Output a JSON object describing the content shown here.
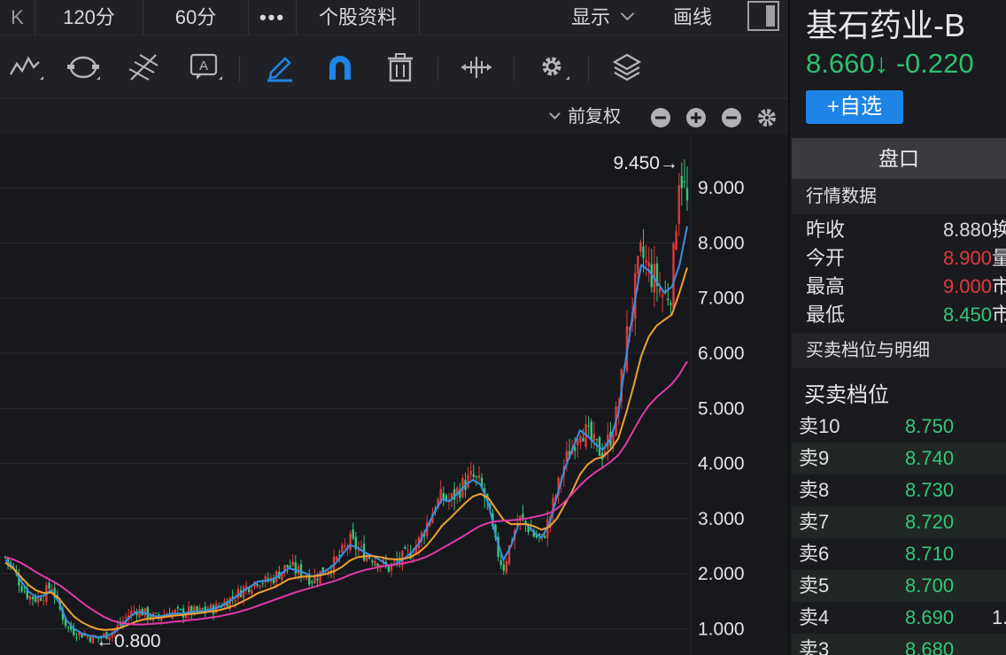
{
  "topbar": {
    "tabs": [
      {
        "label": "K"
      },
      {
        "label": "120分"
      },
      {
        "label": "60分"
      },
      {
        "label": "•••"
      },
      {
        "label": "个股资料"
      }
    ],
    "display_label": "显示",
    "draw_label": "画线"
  },
  "toolbar": {
    "icons": [
      "trendline-icon",
      "cycle-icon",
      "fan-icon",
      "text-annotation-icon",
      "pen-icon",
      "magnet-icon",
      "trash-icon",
      "measure-icon",
      "settings-icon",
      "layers-icon"
    ],
    "active_color": "#1e84e5"
  },
  "subbar": {
    "adjust_label": "前复权",
    "buttons": [
      "zoom-minus-icon",
      "zoom-plus-icon",
      "minus-icon",
      "gear-icon"
    ]
  },
  "chart_data": {
    "type": "candlestick",
    "y_ticks": [
      "9.000",
      "8.000",
      "7.000",
      "6.000",
      "5.000",
      "4.000",
      "3.000",
      "2.000",
      "1.000"
    ],
    "ylim": [
      0.8,
      9.45
    ],
    "grid": true,
    "annotations": {
      "high": "9.450→",
      "low": "←0.800"
    },
    "close": [
      2.3,
      2.1,
      1.8,
      1.6,
      1.55,
      1.62,
      1.8,
      1.4,
      1.05,
      0.95,
      0.9,
      0.85,
      0.82,
      0.88,
      0.95,
      1.08,
      1.25,
      1.35,
      1.3,
      1.22,
      1.2,
      1.28,
      1.3,
      1.28,
      1.32,
      1.3,
      1.35,
      1.36,
      1.42,
      1.52,
      1.6,
      1.72,
      1.8,
      1.9,
      1.85,
      1.92,
      2.05,
      2.15,
      2.05,
      2.0,
      1.9,
      2.0,
      2.1,
      2.2,
      2.4,
      2.6,
      2.45,
      2.35,
      2.3,
      2.2,
      2.1,
      2.2,
      2.3,
      2.4,
      2.6,
      2.9,
      3.2,
      3.4,
      3.3,
      3.5,
      3.65,
      3.75,
      3.6,
      3.2,
      2.5,
      2.1,
      2.6,
      3.0,
      2.9,
      2.7,
      2.6,
      3.0,
      3.5,
      4.0,
      4.3,
      4.7,
      4.5,
      4.3,
      4.2,
      4.5,
      5.0,
      6.2,
      7.0,
      7.8,
      7.5,
      7.3,
      7.0,
      7.2,
      9.45,
      8.66
    ],
    "series": [
      {
        "name": "MA1",
        "color": "#3a8fe0",
        "values": [
          2.25,
          2.12,
          1.88,
          1.68,
          1.58,
          1.6,
          1.7,
          1.48,
          1.15,
          1.0,
          0.92,
          0.88,
          0.85,
          0.86,
          0.92,
          1.02,
          1.18,
          1.3,
          1.3,
          1.25,
          1.22,
          1.25,
          1.28,
          1.28,
          1.3,
          1.31,
          1.33,
          1.36,
          1.4,
          1.48,
          1.57,
          1.68,
          1.77,
          1.86,
          1.87,
          1.9,
          2.0,
          2.1,
          2.06,
          2.02,
          1.95,
          1.98,
          2.07,
          2.17,
          2.35,
          2.52,
          2.47,
          2.38,
          2.32,
          2.24,
          2.15,
          2.18,
          2.27,
          2.38,
          2.55,
          2.82,
          3.12,
          3.35,
          3.32,
          3.45,
          3.6,
          3.7,
          3.62,
          3.3,
          2.7,
          2.25,
          2.5,
          2.9,
          2.9,
          2.75,
          2.65,
          2.9,
          3.4,
          3.9,
          4.25,
          4.6,
          4.5,
          4.35,
          4.25,
          4.45,
          4.9,
          5.9,
          6.8,
          7.6,
          7.5,
          7.3,
          7.1,
          7.2,
          7.6,
          8.3
        ]
      },
      {
        "name": "MA2",
        "color": "#f0a030",
        "values": [
          2.2,
          2.1,
          1.95,
          1.8,
          1.7,
          1.65,
          1.66,
          1.55,
          1.38,
          1.22,
          1.12,
          1.05,
          1.0,
          0.98,
          0.99,
          1.02,
          1.07,
          1.13,
          1.17,
          1.19,
          1.2,
          1.22,
          1.24,
          1.25,
          1.27,
          1.28,
          1.3,
          1.32,
          1.34,
          1.38,
          1.43,
          1.5,
          1.57,
          1.65,
          1.7,
          1.75,
          1.82,
          1.9,
          1.93,
          1.95,
          1.95,
          1.97,
          2.0,
          2.05,
          2.13,
          2.24,
          2.3,
          2.32,
          2.32,
          2.3,
          2.27,
          2.26,
          2.27,
          2.31,
          2.39,
          2.51,
          2.68,
          2.87,
          3.0,
          3.14,
          3.28,
          3.4,
          3.45,
          3.38,
          3.18,
          2.98,
          2.9,
          2.9,
          2.9,
          2.86,
          2.8,
          2.85,
          3.0,
          3.25,
          3.5,
          3.8,
          3.98,
          4.08,
          4.12,
          4.25,
          4.45,
          4.9,
          5.4,
          5.95,
          6.3,
          6.5,
          6.6,
          6.7,
          7.1,
          7.55
        ]
      },
      {
        "name": "MA3",
        "color": "#e03aa8",
        "values": [
          2.3,
          2.26,
          2.2,
          2.12,
          2.03,
          1.95,
          1.88,
          1.8,
          1.7,
          1.59,
          1.48,
          1.38,
          1.29,
          1.21,
          1.15,
          1.11,
          1.09,
          1.08,
          1.08,
          1.09,
          1.1,
          1.11,
          1.13,
          1.14,
          1.16,
          1.17,
          1.19,
          1.21,
          1.23,
          1.26,
          1.29,
          1.33,
          1.37,
          1.42,
          1.47,
          1.52,
          1.57,
          1.62,
          1.67,
          1.71,
          1.75,
          1.79,
          1.83,
          1.87,
          1.92,
          1.98,
          2.03,
          2.07,
          2.1,
          2.13,
          2.15,
          2.17,
          2.19,
          2.22,
          2.26,
          2.31,
          2.38,
          2.46,
          2.54,
          2.62,
          2.7,
          2.79,
          2.87,
          2.92,
          2.95,
          2.96,
          2.97,
          2.98,
          3.0,
          3.03,
          3.06,
          3.1,
          3.18,
          3.3,
          3.45,
          3.6,
          3.73,
          3.84,
          3.93,
          4.03,
          4.15,
          4.35,
          4.6,
          4.85,
          5.05,
          5.2,
          5.32,
          5.44,
          5.62,
          5.85
        ]
      }
    ]
  },
  "stock": {
    "name": "基石药业-B",
    "price_line": "8.660↓ -0.220",
    "add_label": "+自选"
  },
  "panel": {
    "pankou_label": "盘口",
    "quote_header": "行情数据",
    "quotes": [
      {
        "label": "昨收",
        "value": "8.880",
        "extra": "换",
        "color": "neutral"
      },
      {
        "label": "今开",
        "value": "8.900",
        "extra": "量",
        "color": "red"
      },
      {
        "label": "最高",
        "value": "9.000",
        "extra": "市",
        "color": "red"
      },
      {
        "label": "最低",
        "value": "8.450",
        "extra": "市",
        "color": "green"
      }
    ],
    "detail_header": "买卖档位与明细",
    "book_title": "买卖档位",
    "asks": [
      {
        "label": "卖10",
        "price": "8.750",
        "extra": ""
      },
      {
        "label": "卖9",
        "price": "8.740",
        "extra": ""
      },
      {
        "label": "卖8",
        "price": "8.730",
        "extra": ""
      },
      {
        "label": "卖7",
        "price": "8.720",
        "extra": ""
      },
      {
        "label": "卖6",
        "price": "8.710",
        "extra": ""
      },
      {
        "label": "卖5",
        "price": "8.700",
        "extra": ""
      },
      {
        "label": "卖4",
        "price": "8.690",
        "extra": "1."
      },
      {
        "label": "卖3",
        "price": "8.680",
        "extra": ""
      }
    ]
  },
  "colors": {
    "up": "#e03a3a",
    "down": "#35c57a",
    "accent": "#1e84e5"
  }
}
